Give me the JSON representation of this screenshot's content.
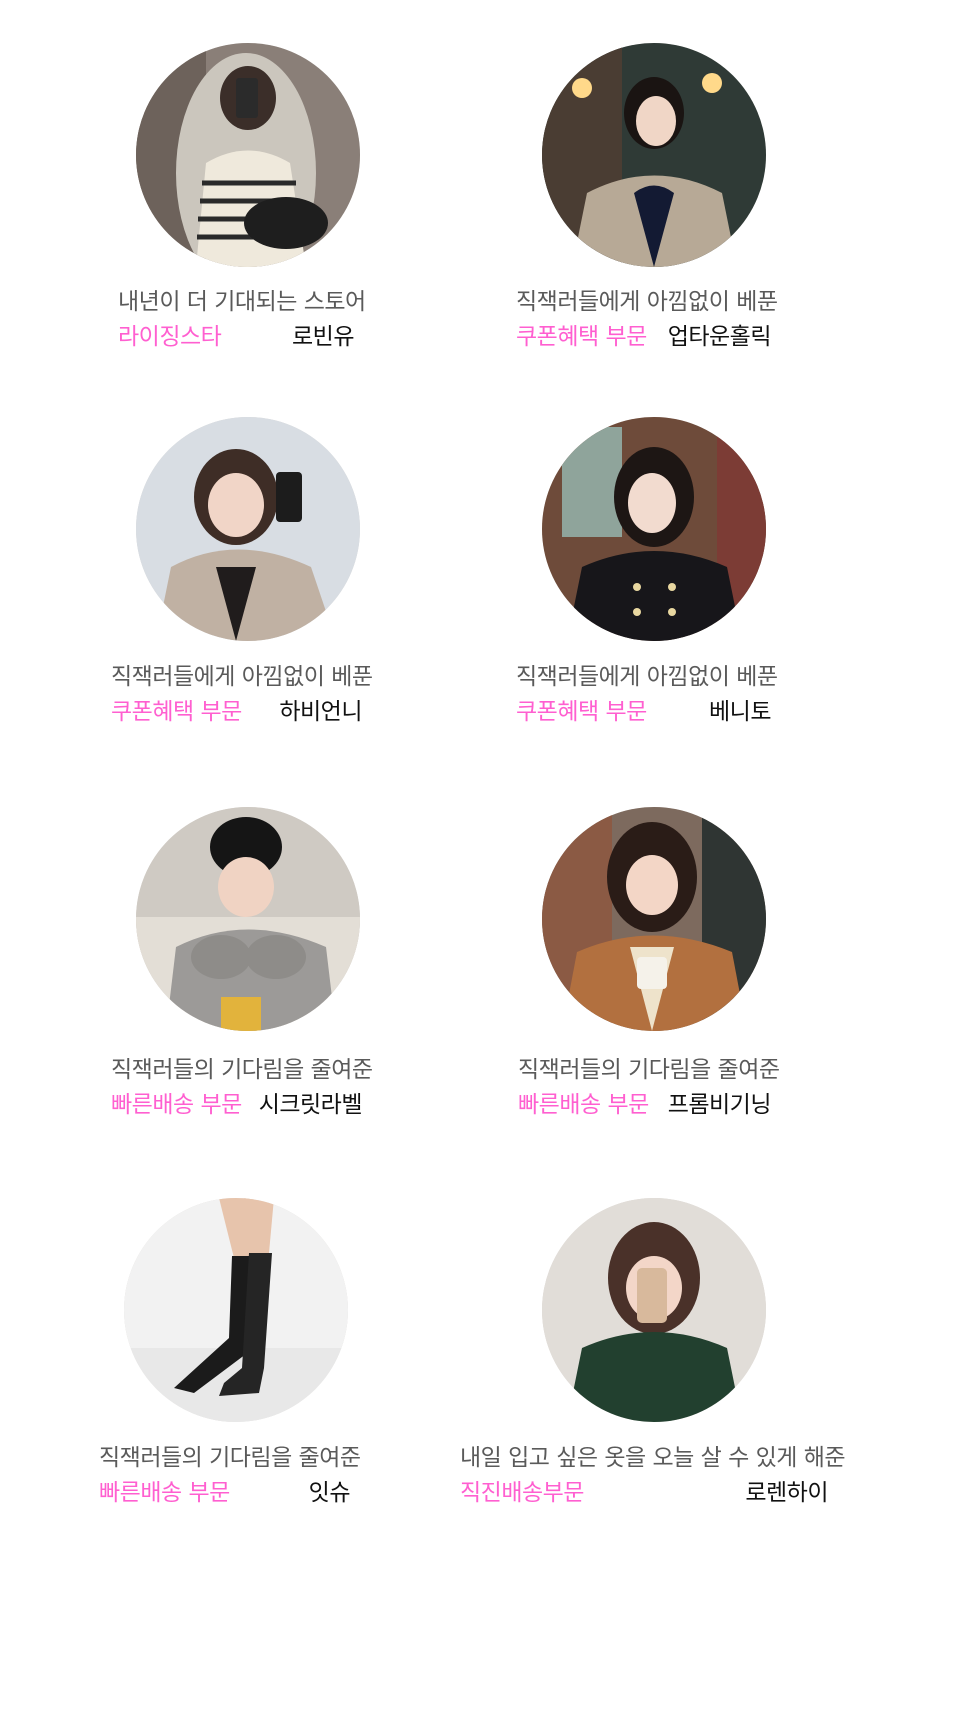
{
  "accent_color": "#ff5fd0",
  "cards": [
    {
      "tagline": "내년이 더 기대되는 스토어",
      "award": "라이징스타",
      "store": "로빈유",
      "photo": "woman-striped-sweater-mirror-selfie-photo"
    },
    {
      "tagline": "직잭러들에게 아낌없이 베푼",
      "award": "쿠폰혜택 부문",
      "store": "업타운홀릭",
      "photo": "woman-tweed-jacket-cafe-photo"
    },
    {
      "tagline": "직잭러들에게 아낌없이 베푼",
      "award": "쿠폰혜택 부문",
      "store": "하비언니",
      "photo": "woman-fur-coat-mirror-selfie-photo"
    },
    {
      "tagline": "직잭러들에게 아낌없이 베푼",
      "award": "쿠폰혜택 부문",
      "store": "베니토",
      "photo": "woman-black-tweed-jacket-photo"
    },
    {
      "tagline": "직잭러들의 기다림을 줄여준",
      "award": "빠른배송 부문",
      "store": "시크릿라벨",
      "photo": "woman-beanie-gray-sweatshirt-photo"
    },
    {
      "tagline": "직잭러들의 기다림을 줄여준",
      "award": "빠른배송 부문",
      "store": "프롬비기닝",
      "photo": "woman-brown-jacket-coffee-mug-photo"
    },
    {
      "tagline": "직잭러들의 기다림을 줄여준",
      "award": "빠른배송 부문",
      "store": "잇슈",
      "photo": "black-knee-high-boots-photo"
    },
    {
      "tagline": "내일 입고 싶은 옷을 오늘 살 수 있게 해준",
      "award": "직진배송부문",
      "store": "로렌하이",
      "photo": "woman-green-sweater-phone-selfie-photo"
    }
  ]
}
